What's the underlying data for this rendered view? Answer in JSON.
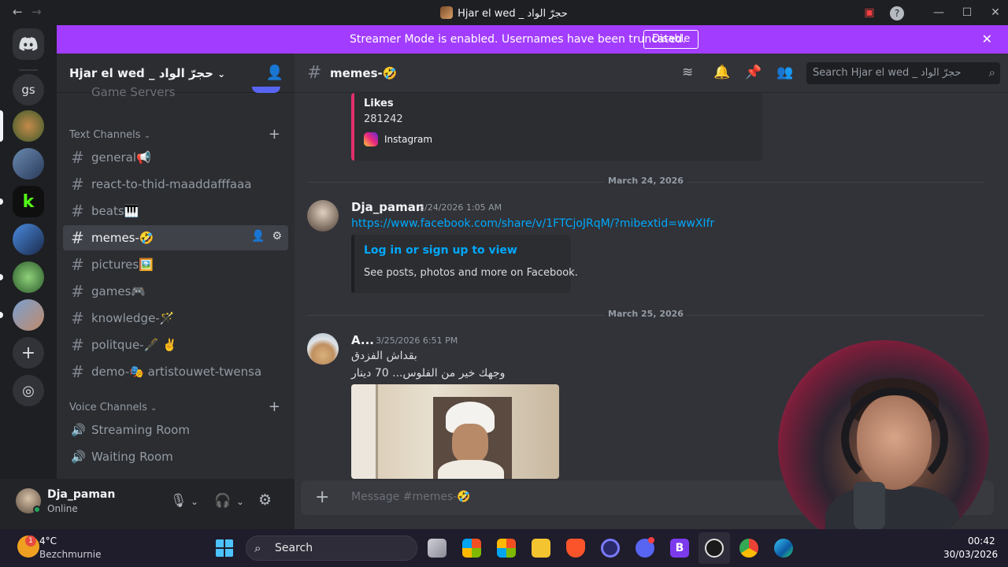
{
  "window": {
    "title": "Hjar el wed _ حجرّ الواد"
  },
  "banner": {
    "text": "Streamer Mode is enabled. Usernames have been truncated.",
    "disable_label": "Disable"
  },
  "rail": {
    "gs_label": "gs"
  },
  "server": {
    "name": "Hjar el wed _ حجرّ الواد"
  },
  "sidebar": {
    "partial_item": "Game Servers",
    "text_category": "Text Channels",
    "voice_category": "Voice Channels",
    "text_channels": [
      {
        "label": "general📢"
      },
      {
        "label": "react-to-thid-maaddafffaaa"
      },
      {
        "label": "beats🎹"
      },
      {
        "label": "memes-🤣"
      },
      {
        "label": "pictures🖼️"
      },
      {
        "label": "games🎮"
      },
      {
        "label": "knowledge-🪄"
      },
      {
        "label": "politque-🖋️ ✌️"
      },
      {
        "label": "demo-🎭 artistouwet-twensa"
      }
    ],
    "voice_channels": [
      {
        "label": "Streaming Room"
      },
      {
        "label": "Waiting Room"
      }
    ]
  },
  "user": {
    "name": "Dja_paman",
    "status": "Online"
  },
  "chat": {
    "channel_name": "memes-🤣",
    "search_placeholder": "Search Hjar el wed _ حجرّ الواد",
    "insta_embed": {
      "field_label": "Likes",
      "field_value": "281242",
      "provider": "Instagram"
    },
    "date_divider_1": "March 24, 2026",
    "msg1": {
      "author": "Dja_paman",
      "timestamp": "3/24/2026 1:05 AM",
      "link": "https://www.facebook.com/share/v/1FTCjoJRqM/?mibextid=wwXIfr",
      "embed_title": "Log in or sign up to view",
      "embed_desc": "See posts, photos and more on Facebook."
    },
    "date_divider_2": "March 25, 2026",
    "msg2": {
      "author": "A...",
      "timestamp": "3/25/2026 6:51 PM",
      "line1": "بقداش الفزدق",
      "line2": "وجهك خير من الفلوس... 70 دينار"
    },
    "composer_placeholder": "Message #memes-🤣"
  },
  "taskbar": {
    "weather_temp": "4°C",
    "weather_place": "Bezchmurnie",
    "weather_badge": "1",
    "search_label": "Search",
    "time": "00:42",
    "date": "30/03/2026"
  },
  "colors": {
    "banner": "#a23dff",
    "link": "#00a8fc",
    "online": "#23a55a",
    "instagram": "#e1306c"
  }
}
